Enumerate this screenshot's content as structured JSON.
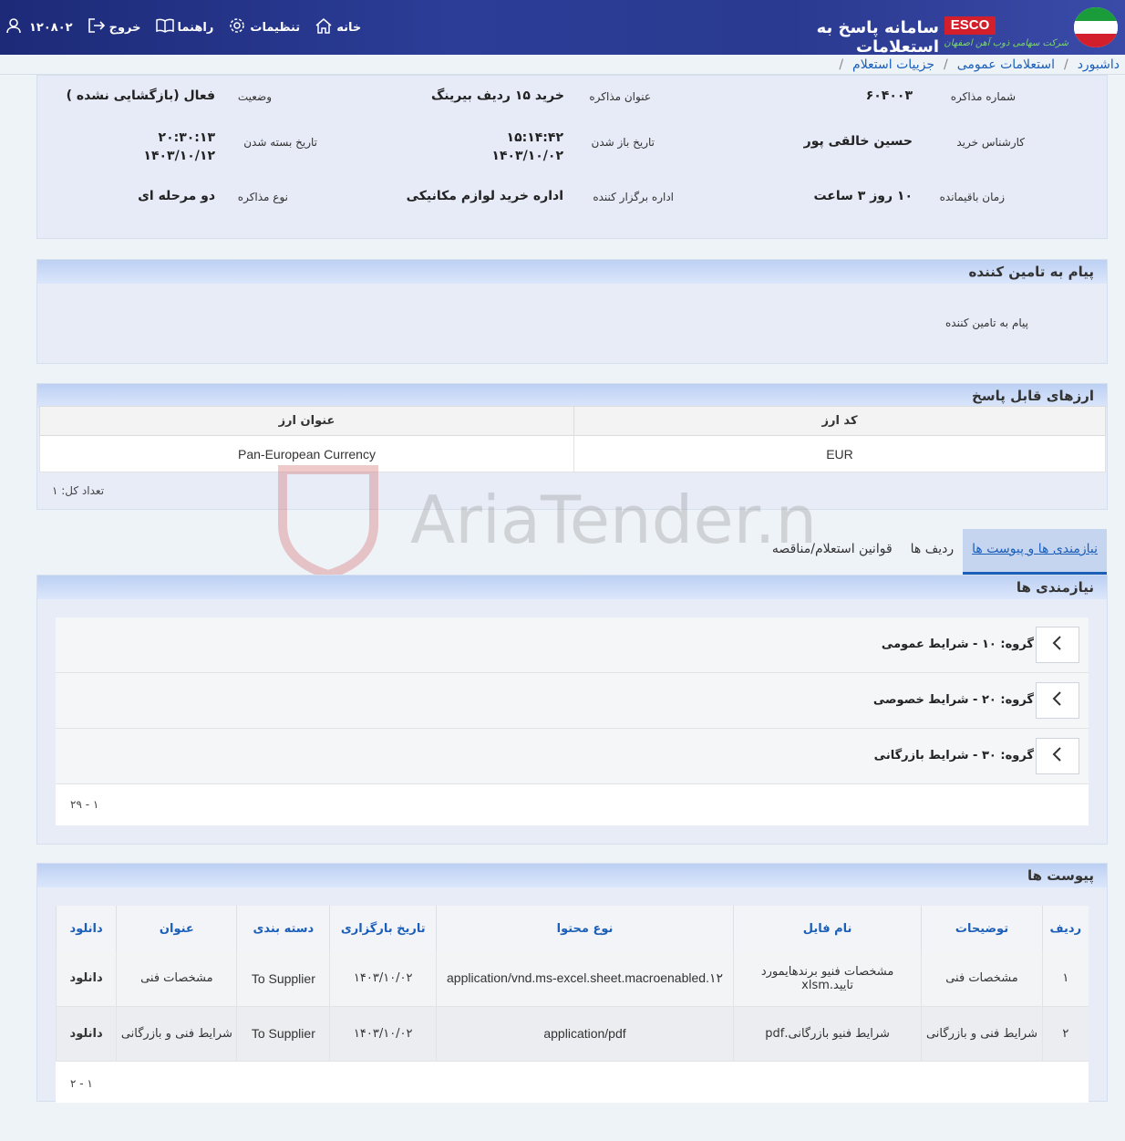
{
  "header": {
    "system_title": "سامانه پاسخ به استعلامات",
    "brand": "ESCO",
    "company": "شرکت سهامی ذوب آهن اصفهان",
    "nav": {
      "home": "خانه",
      "settings": "تنظیمات",
      "guide": "راهنما",
      "logout": "خروج",
      "user_id": "۱۲۰۸۰۲"
    }
  },
  "breadcrumb": [
    "داشبورد",
    "استعلامات عمومی",
    "جزییات استعلام"
  ],
  "info": {
    "negotiation_number_label": "شماره مذاکره",
    "negotiation_number": "۶۰۴۰۰۳",
    "negotiation_title_label": "عنوان مذاکره",
    "negotiation_title": "خرید ۱۵ ردیف بیرینگ",
    "status_label": "وضعیت",
    "status": "فعال (بازگشایی نشده )",
    "expert_label": "کارشناس خرید",
    "expert": "حسین خالقی پور",
    "open_date_label": "تاریخ باز شدن",
    "open_time": "۱۵:۱۴:۴۲",
    "open_date": "۱۴۰۳/۱۰/۰۲",
    "close_date_label": "تاریخ بسته شدن",
    "close_time": "۲۰:۳۰:۱۳",
    "close_date": "۱۴۰۳/۱۰/۱۲",
    "remaining_label": "زمان باقیمانده",
    "remaining": "۱۰ روز ۳ ساعت",
    "organizer_label": "اداره برگزار کننده",
    "organizer": "اداره خرید لوازم مکانیکی",
    "negotiation_type_label": "نوع مذاکره",
    "negotiation_type": "دو مرحله ای"
  },
  "supplier_message": {
    "title": "پیام به تامین کننده",
    "label": "پیام به تامین کننده"
  },
  "currencies": {
    "title": "ارزهای قابل پاسخ",
    "columns": [
      "کد ارز",
      "عنوان ارز"
    ],
    "rows": [
      [
        "EUR",
        "Pan-European Currency"
      ]
    ],
    "count_text": "تعداد کل: ۱"
  },
  "tabs": [
    "نیازمندی ها و پیوست ها",
    "ردیف ها",
    "قوانین استعلام/مناقصه"
  ],
  "requirements": {
    "title": "نیازمندی ها",
    "groups": [
      "گروه: ۱۰ - شرایط عمومی",
      "گروه: ۲۰ - شرایط خصوصی",
      "گروه: ۳۰ - شرایط بازرگانی"
    ],
    "pager": "۱ - ۲۹"
  },
  "attachments": {
    "title": "پیوست ها",
    "columns": [
      "ردیف",
      "توضیحات",
      "نام فایل",
      "نوع محتوا",
      "تاریخ بارگزاری",
      "دسته بندی",
      "عنوان",
      "دانلود"
    ],
    "rows": [
      [
        "۱",
        "مشخصات فنی",
        "مشخصات فنیو برندهایمورد تایید.xlsm",
        "application/vnd.ms-excel.sheet.macroenabled.۱۲",
        "۱۴۰۳/۱۰/۰۲",
        "To Supplier",
        "مشخصات فنی",
        "دانلود"
      ],
      [
        "۲",
        "شرایط فنی و بازرگانی",
        "شرایط فنیو بازرگانی.pdf",
        "application/pdf",
        "۱۴۰۳/۱۰/۰۲",
        "To Supplier",
        "شرایط فنی و بازرگانی",
        "دانلود"
      ]
    ],
    "pager": "۱ - ۲"
  },
  "watermark": "AriaTender.neT",
  "colors": {
    "header_bg": "#2b3d97",
    "link": "#1c5fb8",
    "panel_header": "#bcd0f3",
    "brand_red": "#d31f2b"
  }
}
